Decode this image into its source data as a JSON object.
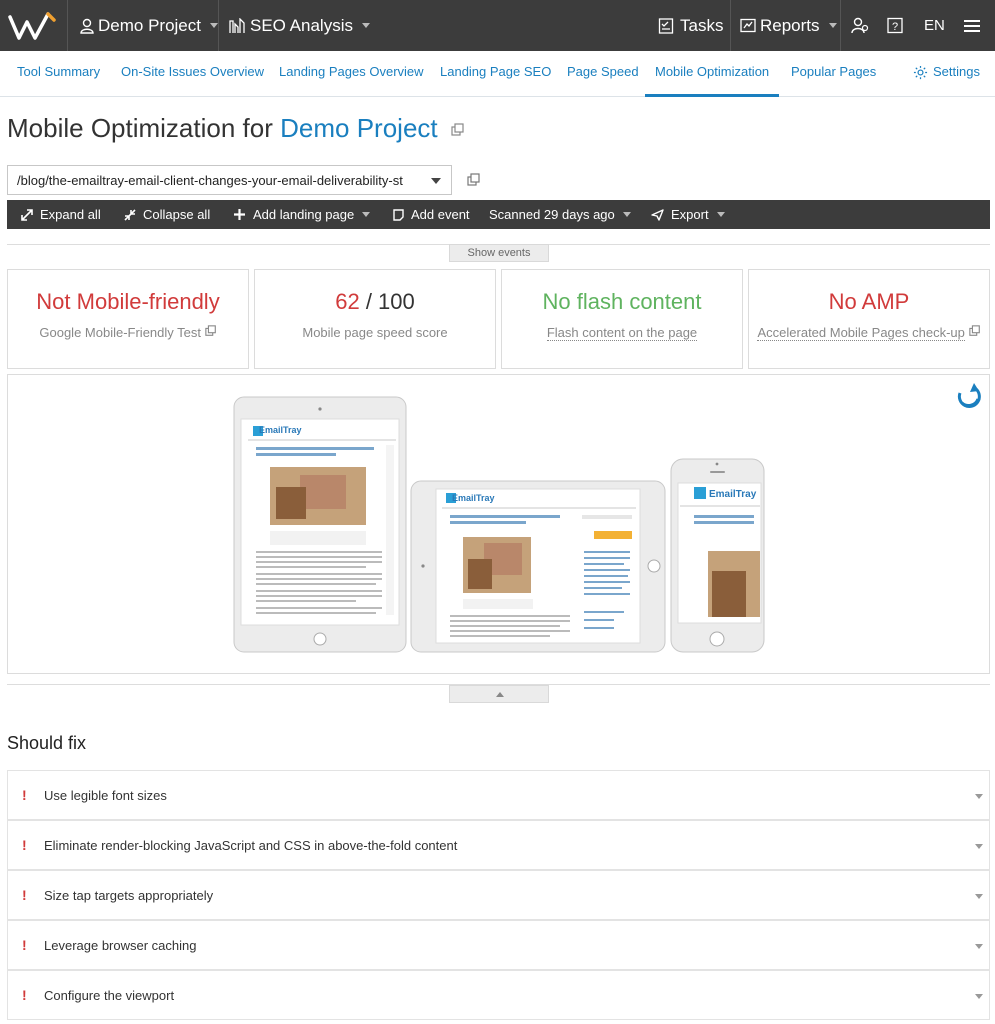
{
  "topbar": {
    "project": "Demo Project",
    "module": "SEO Analysis",
    "tasks": "Tasks",
    "reports": "Reports",
    "lang": "EN"
  },
  "subnav": [
    {
      "label": "Tool Summary"
    },
    {
      "label": "On-Site Issues Overview"
    },
    {
      "label": "Landing Pages Overview"
    },
    {
      "label": "Landing Page SEO"
    },
    {
      "label": "Page Speed"
    },
    {
      "label": "Mobile Optimization"
    },
    {
      "label": "Popular Pages"
    }
  ],
  "settings_label": "Settings",
  "page": {
    "title_prefix": "Mobile Optimization for",
    "title_project": "Demo Project",
    "url": "/blog/the-emailtray-email-client-changes-your-email-deliverability-st"
  },
  "toolbar": {
    "expand": "Expand all",
    "collapse": "Collapse all",
    "add_landing": "Add landing page",
    "add_event": "Add event",
    "scanned": "Scanned 29 days ago",
    "export": "Export"
  },
  "show_events": "Show events",
  "cards": [
    {
      "value": "Not Mobile-friendly",
      "label": "Google Mobile-Friendly Test"
    },
    {
      "value": "62",
      "value_suffix": "/ 100",
      "label": "Mobile page speed score"
    },
    {
      "value": "No flash content",
      "label": "Flash content on the page"
    },
    {
      "value": "No AMP",
      "label": "Accelerated Mobile Pages check-up"
    }
  ],
  "preview": {
    "brand": "EmailTray",
    "headline": "The EmailTray Email Client Changes Your Email Deliverability Statistics"
  },
  "should_fix": {
    "title": "Should fix",
    "items": [
      "Use legible font sizes",
      "Eliminate render-blocking JavaScript and CSS in above-the-fold content",
      "Size tap targets appropriately",
      "Leverage browser caching",
      "Configure the viewport"
    ]
  },
  "colors": {
    "accent": "#1a7fbf",
    "bad": "#d13b3b",
    "good": "#5fb35f",
    "bar": "#3c3c3c"
  }
}
